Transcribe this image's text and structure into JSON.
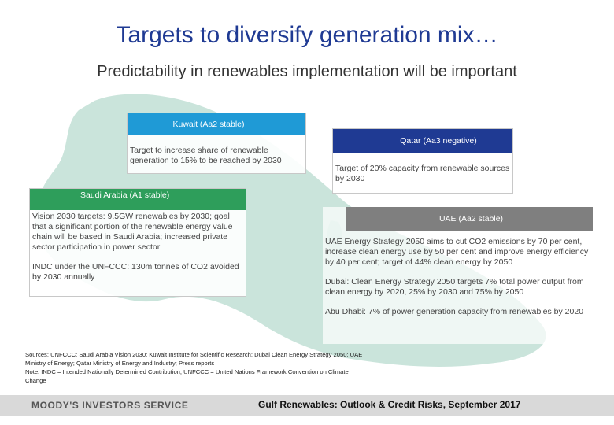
{
  "title": "Targets to diversify generation mix…",
  "subtitle": "Predictability in renewables implementation will be important",
  "kuwait": {
    "header": "Kuwait (Aa2 stable)",
    "text": "Target to increase share of renewable generation to 15% to be reached by 2030"
  },
  "qatar": {
    "header": "Qatar (Aa3 negative)",
    "text": "Target of 20% capacity from renewable sources by 2030"
  },
  "saudi": {
    "header": "Saudi Arabia (A1 stable)",
    "text1": "Vision 2030 targets: 9.5GW renewables by 2030; goal that a significant portion of the renewable energy value chain will be based in Saudi Arabia; increased private sector participation in power sector",
    "text2": "INDC under the UNFCCC: 130m tonnes of CO2 avoided by 2030 annually"
  },
  "uae": {
    "header": "UAE (Aa2 stable)",
    "text1": "UAE Energy Strategy 2050 aims to cut CO2 emissions by 70 per cent, increase clean energy use by 50 per cent and improve energy efficiency by 40 per cent; target of 44% clean energy by 2050",
    "text2": "Dubai: Clean Energy Strategy 2050 targets 7% total power output from clean energy by 2020, 25% by 2030 and 75% by 2050",
    "text3": "Abu Dhabi: 7% of power generation capacity from renewables by 2020"
  },
  "sources": {
    "line1": "Sources: UNFCCC; Saudi Arabia Vision 2030; Kuwait Institute for Scientific Research; Dubai Clean Energy Strategy 2050; UAE",
    "line2": "Ministry of Energy; Qatar Ministry of Energy and Industry; Press reports",
    "line3": "Note: INDC = Intended Nationally Determined Contribution; UNFCCC = United Nations Framework Convention on Climate",
    "line4": "Change"
  },
  "footer": {
    "logo": "MOODY'S INVESTORS SERVICE",
    "report_title": "Gulf Renewables: Outlook & Credit Risks, September 2017"
  },
  "colors": {
    "kuwait_header": "#1f9ad6",
    "qatar_header": "#1f3a93",
    "saudi_header": "#2e9e5b",
    "uae_header": "#7f7f7f",
    "map": "#b3d9cc",
    "title": "#1f3a93"
  }
}
